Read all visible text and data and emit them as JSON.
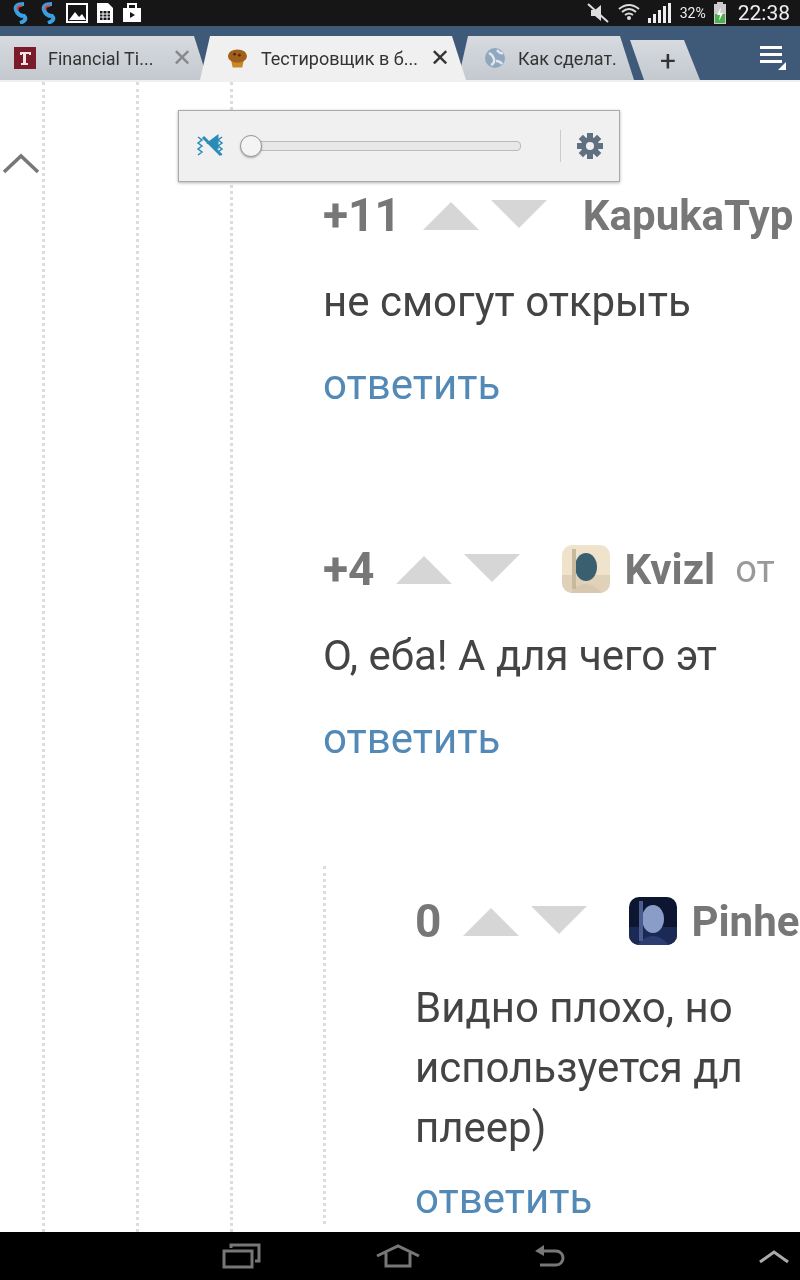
{
  "status_bar": {
    "battery_percent": "32%",
    "time": "22:38"
  },
  "tabs": [
    {
      "title": "Financial Ti...",
      "close": "✕",
      "selected": false
    },
    {
      "title": "Тестировщик в б...",
      "close": "✕",
      "selected": true
    },
    {
      "title": "Как сделат.",
      "selected": false
    }
  ],
  "new_tab": "+",
  "volume_popup": {
    "muted": true,
    "level": 0
  },
  "comments": [
    {
      "score": "+11",
      "author": "KapukaTyp",
      "has_avatar": false,
      "text": [
        "не смогут открыть"
      ],
      "reply": "ответить"
    },
    {
      "score": "+4",
      "author": "Kvizl",
      "has_avatar": true,
      "author_suffix": "от",
      "text": [
        "О, еба! А для чего эт"
      ],
      "reply": "ответить"
    }
  ],
  "replies": [
    {
      "score": "0",
      "author": "Pinhe",
      "has_avatar": true,
      "text": [
        "Видно плохо, но",
        "используется дл",
        "плеер)"
      ],
      "reply": "ответить"
    }
  ]
}
